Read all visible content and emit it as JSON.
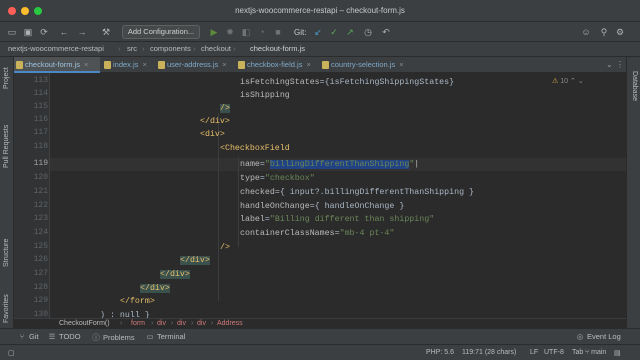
{
  "window": {
    "title": "nextjs-woocommerce-restapi – checkout-form.js",
    "traffic_colors": [
      "#ff5f57",
      "#febc2e",
      "#28c840"
    ]
  },
  "toolbar": {
    "add_configuration": "Add Configuration...",
    "git_label": "Git:",
    "icons": [
      "back-arrow-icon",
      "forward-arrow-icon",
      "run-icon",
      "debug-icon",
      "coverage-icon",
      "profile-icon",
      "stop-icon",
      "git-update-icon",
      "git-commit-icon",
      "git-push-icon",
      "history-icon",
      "rollback-icon",
      "search-icon"
    ]
  },
  "navbar": {
    "crumbs": [
      "nextjs-woocommerce-restapi",
      "src",
      "components",
      "checkout",
      "checkout-form.js"
    ]
  },
  "tabs": [
    {
      "label": "checkout-form.js",
      "active": true
    },
    {
      "label": "index.js",
      "active": false
    },
    {
      "label": "user-address.js",
      "active": false
    },
    {
      "label": "checkbox-field.js",
      "active": false
    },
    {
      "label": "country-selection.js",
      "active": false
    }
  ],
  "left_panels": [
    "Project",
    "Pull Requests",
    "Structure",
    "Favorites"
  ],
  "right_panels": [
    "Database"
  ],
  "editor": {
    "inspection": "10",
    "line_numbers": [
      "113",
      "114",
      "115",
      "116",
      "117",
      "118",
      "119",
      "120",
      "121",
      "122",
      "123",
      "124",
      "125",
      "126",
      "127",
      "128",
      "129",
      "130"
    ],
    "current_line": "119",
    "lines": {
      "l113": {
        "attr": "isFetchingStates",
        "eq": "=",
        "val": "{isFetchingShippingStates}"
      },
      "l114": {
        "attr": "isShipping"
      },
      "l115": {
        "tag": "/>"
      },
      "l116": {
        "tag": "</div>"
      },
      "l117": {
        "tag": "<div>"
      },
      "l118": {
        "tag": "<CheckboxField"
      },
      "l119": {
        "attr": "name",
        "eq": "=",
        "q1": "\"",
        "val": "billingDifferentThanShipping",
        "q2": "\""
      },
      "l120": {
        "attr": "type",
        "eq": "=",
        "val": "\"checkbox\""
      },
      "l121": {
        "attr": "checked",
        "eq": "=",
        "val": "{ input?.billingDifferentThanShipping }"
      },
      "l122": {
        "attr": "handleOnChange",
        "eq": "=",
        "val": "{ handleOnChange }"
      },
      "l123": {
        "attr": "label",
        "eq": "=",
        "val": "\"Billing different than shipping\""
      },
      "l124": {
        "attr": "containerClassNames",
        "eq": "=",
        "val": "\"mb-4 pt-4\""
      },
      "l125": {
        "tag": "/>"
      },
      "l126": {
        "tag": "</div>"
      },
      "l127": {
        "tag": "</div>"
      },
      "l128": {
        "tag": "</div>"
      },
      "l129": {
        "tag": "</form>"
      },
      "l130": {
        "text": ") : null }"
      }
    }
  },
  "code_crumbs": [
    "CheckoutForm()",
    "form",
    "div",
    "div",
    "div",
    "Address"
  ],
  "bottom_tools": {
    "git": "Git",
    "todo": "TODO",
    "problems": "Problems",
    "terminal": "Terminal",
    "event_log": "Event Log"
  },
  "status": {
    "php": "PHP: 5.6",
    "position": "119:71 (28 chars)",
    "line_sep": "LF",
    "encoding": "UTF-8",
    "indent": "Tab",
    "branch": "main"
  }
}
